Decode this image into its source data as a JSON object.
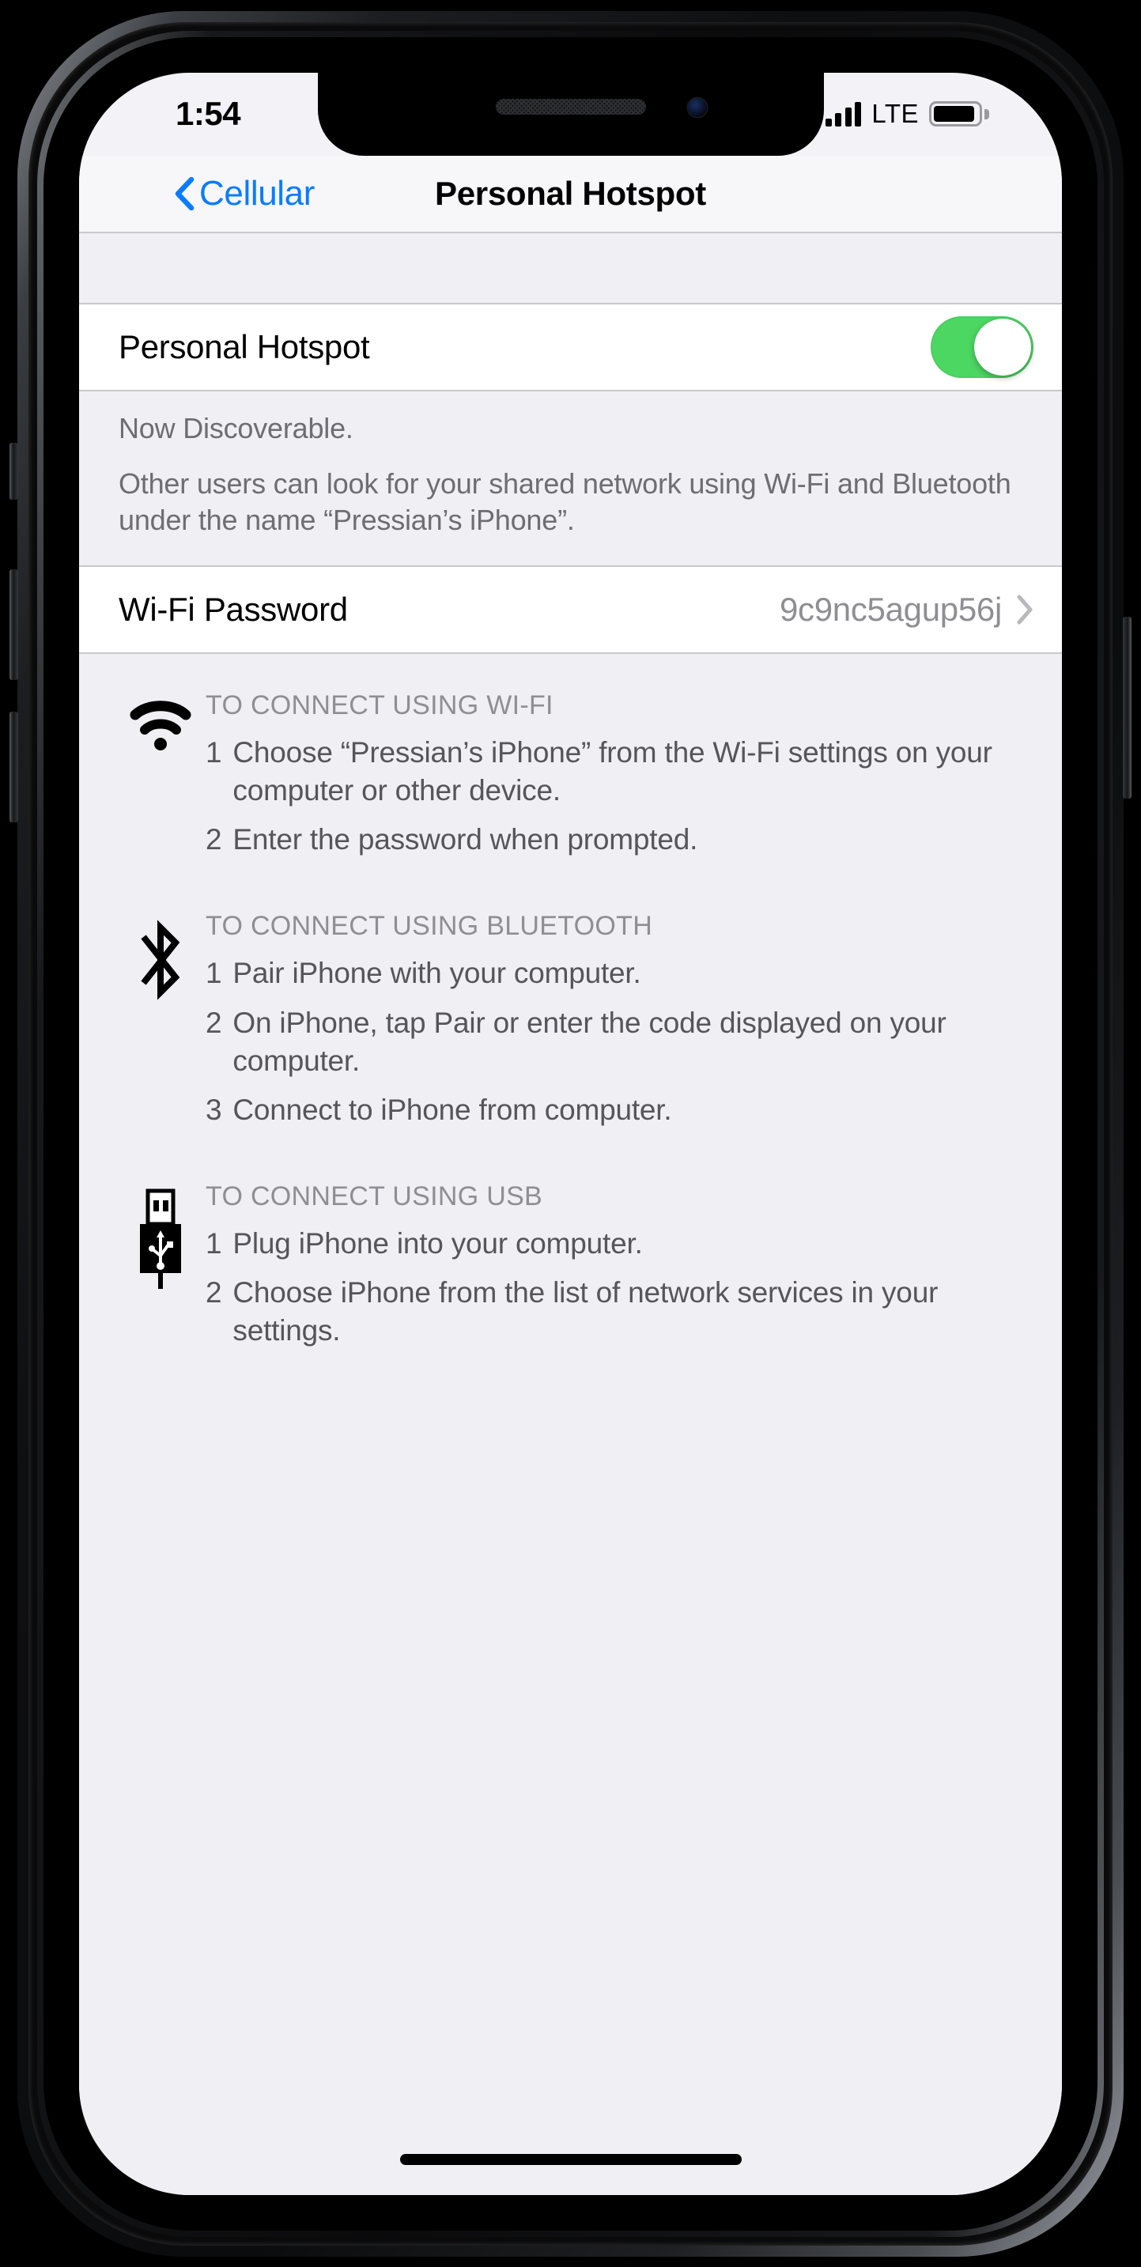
{
  "status_bar": {
    "time": "1:54",
    "carrier_tech": "LTE",
    "signal_icon": "cellular-signal-icon",
    "signal_bars_filled": 4,
    "signal_bars_total": 4,
    "battery_icon": "battery-icon",
    "battery_level_percent": 92
  },
  "nav_bar": {
    "back_label": "Cellular",
    "back_icon": "chevron-left-icon",
    "title": "Personal Hotspot"
  },
  "hotspot_row": {
    "label": "Personal Hotspot",
    "toggle_state": "on",
    "toggle_on_color": "#4cd662"
  },
  "discoverable": {
    "status": "Now Discoverable.",
    "description": "Other users can look for your shared network using Wi-Fi and Bluetooth under the name “Pressian’s iPhone”."
  },
  "wifi_password_row": {
    "label": "Wi-Fi Password",
    "value": "9c9nc5agup56j",
    "chevron_icon": "chevron-right-icon"
  },
  "instructions": [
    {
      "icon": "wifi-icon",
      "heading": "TO CONNECT USING WI-FI",
      "steps": [
        {
          "num": "1",
          "text": "Choose “Pressian’s iPhone” from the Wi-Fi settings on your computer or other device."
        },
        {
          "num": "2",
          "text": "Enter the password when prompted."
        }
      ]
    },
    {
      "icon": "bluetooth-icon",
      "heading": "TO CONNECT USING BLUETOOTH",
      "steps": [
        {
          "num": "1",
          "text": "Pair iPhone with your computer."
        },
        {
          "num": "2",
          "text": "On iPhone, tap Pair or enter the code displayed on your computer."
        },
        {
          "num": "3",
          "text": "Connect to iPhone from computer."
        }
      ]
    },
    {
      "icon": "usb-icon",
      "heading": "TO CONNECT USING USB",
      "steps": [
        {
          "num": "1",
          "text": "Plug iPhone into your computer."
        },
        {
          "num": "2",
          "text": "Choose iPhone from the list of network services in your settings."
        }
      ]
    }
  ],
  "home_indicator": "home-indicator",
  "colors": {
    "accent_blue": "#0a7cff",
    "toggle_green": "#4cd662",
    "secondary_text": "#6d6d72",
    "group_background": "#efeff4",
    "cell_background": "#ffffff"
  }
}
